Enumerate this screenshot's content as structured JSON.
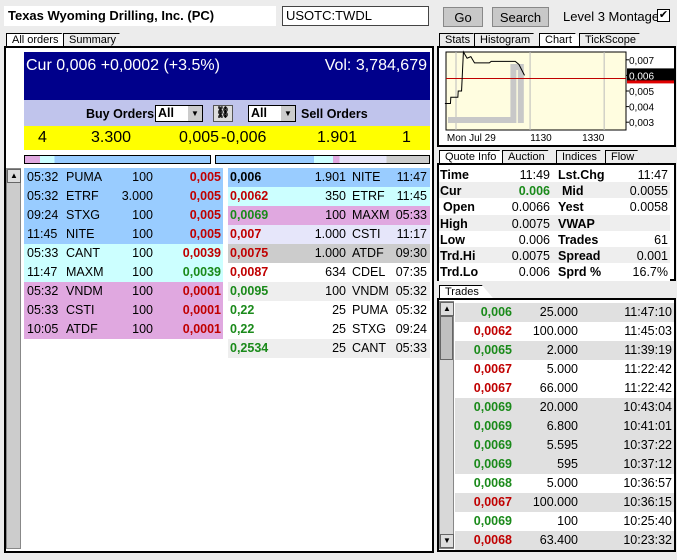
{
  "header": {
    "company": "Texas Wyoming Drilling, Inc. (PC)",
    "symbol": "USOTC:TWDL",
    "go": "Go",
    "search": "Search",
    "montage_label": "Level 3 Montage",
    "montage_checked": true
  },
  "left_tabs": [
    "All orders",
    "Summary"
  ],
  "summary": {
    "cur": "Cur 0,006 +0,0002 (+3.5%)",
    "vol": "Vol: 3,784,679"
  },
  "filters": {
    "buy_label": "Buy Orders",
    "buy_value": "All",
    "sell_value": "All",
    "sell_label": "Sell Orders"
  },
  "inside": {
    "bid_count": "4",
    "bid_size": "3.300",
    "bid": "0,005",
    "ask": "-0,006",
    "ask_size": "1.901",
    "ask_count": "1"
  },
  "colors": {
    "header_bg": "#00008b",
    "filter_bg": "#c0c4ec",
    "inside_bg": "#ffff00",
    "lvl1": "#99ccff",
    "lvl2": "#ccffff",
    "lvl3": "#e0a8e0",
    "lvl4": "#e6e6fa",
    "lvl5": "#cccccc",
    "up": "#1a8a1a",
    "down": "#c00000"
  },
  "bids": [
    {
      "time": "05:32",
      "mm": "PUMA",
      "size": "100",
      "price": "0,005",
      "dir": "red",
      "lvl": "lvl1"
    },
    {
      "time": "05:32",
      "mm": "ETRF",
      "size": "3.000",
      "price": "0,005",
      "dir": "red",
      "lvl": "lvl1"
    },
    {
      "time": "09:24",
      "mm": "STXG",
      "size": "100",
      "price": "0,005",
      "dir": "red",
      "lvl": "lvl1"
    },
    {
      "time": "11:45",
      "mm": "NITE",
      "size": "100",
      "price": "0,005",
      "dir": "red",
      "lvl": "lvl1"
    },
    {
      "time": "05:33",
      "mm": "CANT",
      "size": "100",
      "price": "0,0039",
      "dir": "red",
      "lvl": "lvl2"
    },
    {
      "time": "11:47",
      "mm": "MAXM",
      "size": "100",
      "price": "0,0039",
      "dir": "green",
      "lvl": "lvl2"
    },
    {
      "time": "05:32",
      "mm": "VNDM",
      "size": "100",
      "price": "0,0001",
      "dir": "red",
      "lvl": "lvl3"
    },
    {
      "time": "05:33",
      "mm": "CSTI",
      "size": "100",
      "price": "0,0001",
      "dir": "red",
      "lvl": "lvl3"
    },
    {
      "time": "10:05",
      "mm": "ATDF",
      "size": "100",
      "price": "0,0001",
      "dir": "red",
      "lvl": "lvl3"
    }
  ],
  "asks": [
    {
      "price": "0,006",
      "size": "1.901",
      "mm": "NITE",
      "time": "11:47",
      "dir": "blk",
      "lvl": "lvl1"
    },
    {
      "price": "0,0062",
      "size": "350",
      "mm": "ETRF",
      "time": "11:45",
      "dir": "red",
      "lvl": "lvl2"
    },
    {
      "price": "0,0069",
      "size": "100",
      "mm": "MAXM",
      "time": "05:33",
      "dir": "green",
      "lvl": "lvl3"
    },
    {
      "price": "0,007",
      "size": "1.000",
      "mm": "CSTI",
      "time": "11:17",
      "dir": "red",
      "lvl": "lvl4"
    },
    {
      "price": "0,0075",
      "size": "1.000",
      "mm": "ATDF",
      "time": "09:30",
      "dir": "red",
      "lvl": "lvl5"
    },
    {
      "price": "0,0087",
      "size": "634",
      "mm": "CDEL",
      "time": "07:35",
      "dir": "red",
      "lvl": "white"
    },
    {
      "price": "0,0095",
      "size": "100",
      "mm": "VNDM",
      "time": "05:32",
      "dir": "green",
      "lvl": "alt"
    },
    {
      "price": "0,22",
      "size": "25",
      "mm": "PUMA",
      "time": "05:32",
      "dir": "green",
      "lvl": "white"
    },
    {
      "price": "0,22",
      "size": "25",
      "mm": "STXG",
      "time": "09:24",
      "dir": "green",
      "lvl": "white"
    },
    {
      "price": "0,2534",
      "size": "25",
      "mm": "CANT",
      "time": "05:33",
      "dir": "green",
      "lvl": "alt"
    }
  ],
  "right_tabs": [
    "Stats",
    "Histogram",
    "Chart",
    "TickScope"
  ],
  "chart_data": {
    "type": "line",
    "x_ticks": [
      "Mon Jul 29",
      "1130",
      "1330"
    ],
    "y_ticks": [
      "0,007",
      "0,006",
      "0,005",
      "0,004",
      "0,003"
    ],
    "current_label": "0,006",
    "reference_price": 0.0058,
    "price": [
      [
        9.2,
        0.0042
      ],
      [
        9.35,
        0.0042
      ],
      [
        9.36,
        0.0046
      ],
      [
        9.55,
        0.0046
      ],
      [
        9.56,
        0.005
      ],
      [
        9.65,
        0.005
      ],
      [
        9.7,
        0.0075
      ],
      [
        9.8,
        0.0071
      ],
      [
        9.9,
        0.0072
      ],
      [
        10.0,
        0.0068
      ],
      [
        10.4,
        0.0068
      ],
      [
        10.45,
        0.0069
      ],
      [
        11.1,
        0.0069
      ],
      [
        11.2,
        0.0067
      ],
      [
        11.35,
        0.006
      ]
    ],
    "ylim": [
      0.0025,
      0.0075
    ]
  },
  "quote_tabs": [
    "Quote Info",
    "Auction",
    "Indices",
    "Flow"
  ],
  "quote": [
    {
      "l": "Time",
      "lv": "11:49",
      "r": "Lst.Chg",
      "rv": "11:47"
    },
    {
      "l": "Cur",
      "lv": "0.006",
      "r": "Mid",
      "rv": "0.0055"
    },
    {
      "l": "Open",
      "lv": "0.0066",
      "r": "Yest",
      "rv": "0.0058"
    },
    {
      "l": "High",
      "lv": "0.0075",
      "r": "VWAP",
      "rv": ""
    },
    {
      "l": "Low",
      "lv": "0.006",
      "r": "Trades",
      "rv": "61"
    },
    {
      "l": "Trd.Hi",
      "lv": "0.0075",
      "r": "Spread",
      "rv": "0.001"
    },
    {
      "l": "Trd.Lo",
      "lv": "0.006",
      "r": "Sprd %",
      "rv": "16.7%"
    }
  ],
  "trades_tab": "Trades",
  "trades": [
    {
      "price": "0,006",
      "size": "25.000",
      "time": "11:47:10",
      "dir": "green",
      "bg": "#e0e0e0"
    },
    {
      "price": "0,0062",
      "size": "100.000",
      "time": "11:45:03",
      "dir": "red",
      "bg": "#ffffff"
    },
    {
      "price": "0,0065",
      "size": "2.000",
      "time": "11:39:19",
      "dir": "green",
      "bg": "#e0e0e0"
    },
    {
      "price": "0,0067",
      "size": "5.000",
      "time": "11:22:42",
      "dir": "red",
      "bg": "#ffffff"
    },
    {
      "price": "0,0067",
      "size": "66.000",
      "time": "11:22:42",
      "dir": "red",
      "bg": "#ffffff"
    },
    {
      "price": "0,0069",
      "size": "20.000",
      "time": "10:43:04",
      "dir": "green",
      "bg": "#e0e0e0"
    },
    {
      "price": "0,0069",
      "size": "6.800",
      "time": "10:41:01",
      "dir": "green",
      "bg": "#e0e0e0"
    },
    {
      "price": "0,0069",
      "size": "5.595",
      "time": "10:37:22",
      "dir": "green",
      "bg": "#e0e0e0"
    },
    {
      "price": "0,0069",
      "size": "595",
      "time": "10:37:12",
      "dir": "green",
      "bg": "#e0e0e0"
    },
    {
      "price": "0,0068",
      "size": "5.000",
      "time": "10:36:57",
      "dir": "green",
      "bg": "#ffffff"
    },
    {
      "price": "0,0067",
      "size": "100.000",
      "time": "10:36:15",
      "dir": "red",
      "bg": "#e0e0e0"
    },
    {
      "price": "0,0069",
      "size": "100",
      "time": "10:25:40",
      "dir": "green",
      "bg": "#ffffff"
    },
    {
      "price": "0,0068",
      "size": "63.400",
      "time": "10:23:32",
      "dir": "red",
      "bg": "#e0e0e0"
    }
  ]
}
